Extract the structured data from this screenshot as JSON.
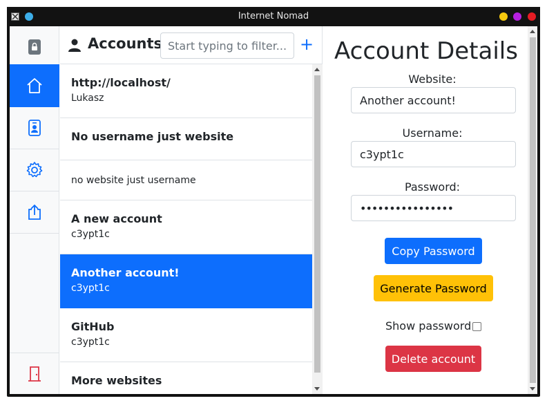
{
  "window": {
    "title": "Internet Nomad",
    "controls": {
      "yellow": "#f6c90e",
      "purple": "#b620e0",
      "red": "#e51c23"
    },
    "left_dot_color": "#3daee9"
  },
  "nav": {
    "items": [
      {
        "icon": "lock-icon",
        "active": false
      },
      {
        "icon": "home-icon",
        "active": true
      },
      {
        "icon": "person-badge-icon",
        "active": false
      },
      {
        "icon": "gear-icon",
        "active": false
      },
      {
        "icon": "upload-icon",
        "active": false
      },
      {
        "icon": "door-exit-icon",
        "active": false
      }
    ]
  },
  "accounts": {
    "title": "Accounts",
    "filter_placeholder": "Start typing to filter...",
    "add_label": "+",
    "items": [
      {
        "website": "http://localhost/",
        "username": "Lukasz"
      },
      {
        "website": "No username just website",
        "username": ""
      },
      {
        "website": "",
        "username": "no website just username"
      },
      {
        "website": "A new account",
        "username": "c3ypt1c"
      },
      {
        "website": "Another account!",
        "username": "c3ypt1c",
        "selected": true
      },
      {
        "website": "GitHub",
        "username": "c3ypt1c"
      },
      {
        "website": "More websites",
        "username": ""
      }
    ]
  },
  "details": {
    "title": "Account Details",
    "website_label": "Website:",
    "website_value": "Another account!",
    "username_label": "Username:",
    "username_value": "c3ypt1c",
    "password_label": "Password:",
    "password_value": "••••••••••••••••",
    "copy_password": "Copy Password",
    "generate_password": "Generate Password",
    "show_password": "Show password:",
    "delete_account": "Delete account"
  },
  "colors": {
    "primary": "#0d6efd",
    "warning": "#ffc107",
    "danger": "#dc3545"
  }
}
